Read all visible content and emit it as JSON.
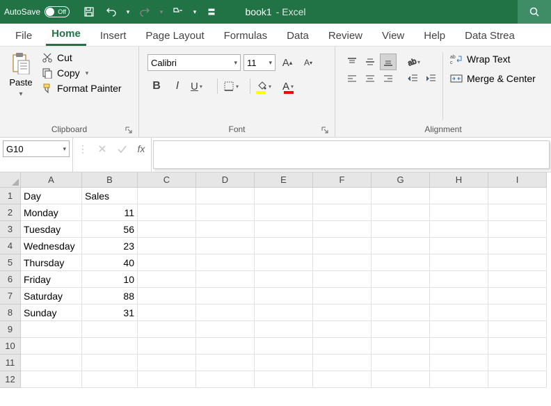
{
  "titlebar": {
    "autosave_label": "AutoSave",
    "autosave_state": "Off",
    "filename": "book1",
    "app_suffix": " -  Excel"
  },
  "tabs": [
    "File",
    "Home",
    "Insert",
    "Page Layout",
    "Formulas",
    "Data",
    "Review",
    "View",
    "Help",
    "Data Strea"
  ],
  "active_tab": "Home",
  "ribbon": {
    "clipboard": {
      "paste": "Paste",
      "cut": "Cut",
      "copy": "Copy",
      "format_painter": "Format Painter",
      "group_label": "Clipboard"
    },
    "font": {
      "name": "Calibri",
      "size": "11",
      "group_label": "Font"
    },
    "alignment": {
      "wrap": "Wrap Text",
      "merge": "Merge & Center",
      "group_label": "Alignment"
    }
  },
  "namebox": "G10",
  "formula": "",
  "columns": [
    "A",
    "B",
    "C",
    "D",
    "E",
    "F",
    "G",
    "H",
    "I"
  ],
  "row_count": 12,
  "sheet": {
    "headers": [
      "Day",
      "Sales"
    ],
    "rows": [
      [
        "Monday",
        "11"
      ],
      [
        "Tuesday",
        "56"
      ],
      [
        "Wednesday",
        "23"
      ],
      [
        "Thursday",
        "40"
      ],
      [
        "Friday",
        "10"
      ],
      [
        "Saturday",
        "88"
      ],
      [
        "Sunday",
        "31"
      ]
    ]
  },
  "chart_data": {
    "type": "table",
    "columns": [
      "Day",
      "Sales"
    ],
    "rows": [
      [
        "Monday",
        11
      ],
      [
        "Tuesday",
        56
      ],
      [
        "Wednesday",
        23
      ],
      [
        "Thursday",
        40
      ],
      [
        "Friday",
        10
      ],
      [
        "Saturday",
        88
      ],
      [
        "Sunday",
        31
      ]
    ]
  }
}
